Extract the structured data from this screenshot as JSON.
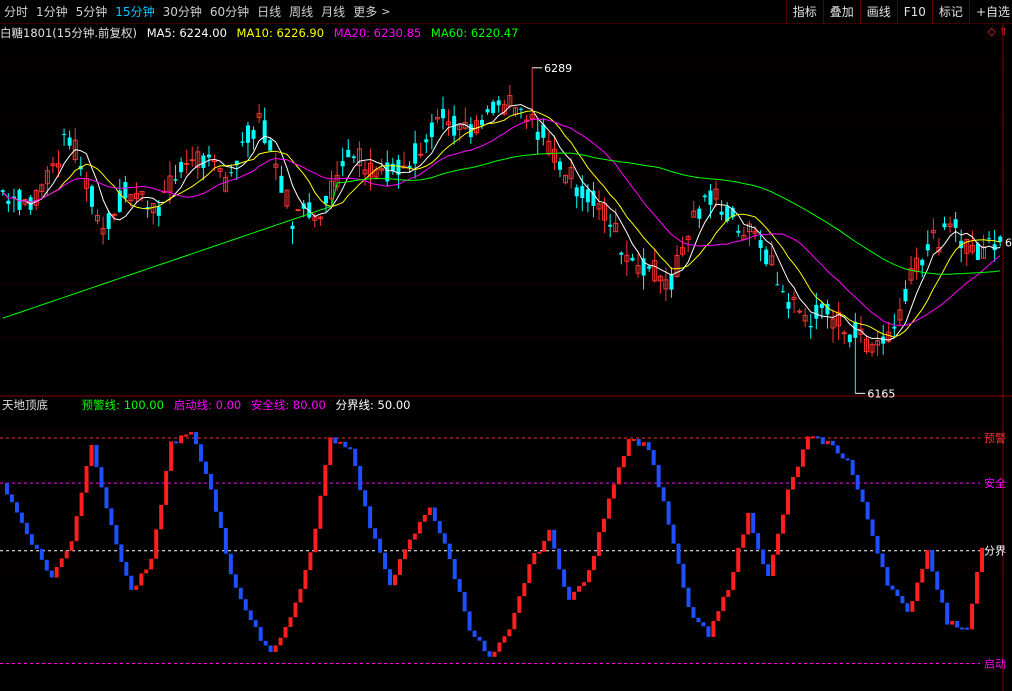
{
  "period_tabs": [
    {
      "label": "分时",
      "active": false
    },
    {
      "label": "1分钟",
      "active": false
    },
    {
      "label": "5分钟",
      "active": false
    },
    {
      "label": "15分钟",
      "active": true
    },
    {
      "label": "30分钟",
      "active": false
    },
    {
      "label": "60分钟",
      "active": false
    },
    {
      "label": "日线",
      "active": false
    },
    {
      "label": "周线",
      "active": false
    },
    {
      "label": "月线",
      "active": false
    }
  ],
  "more_label": "更多",
  "right_tools": [
    "指标",
    "叠加",
    "画线",
    "F10",
    "标记",
    "+自选"
  ],
  "main_panel": {
    "symbol": "白糖1801(15分钟.前复权)",
    "ma5": {
      "label": "MA5:",
      "value": "6224.00",
      "color": "#ffffff"
    },
    "ma10": {
      "label": "MA10:",
      "value": "6226.90",
      "color": "#ffff00"
    },
    "ma20": {
      "label": "MA20:",
      "value": "6230.85",
      "color": "#ff00ff"
    },
    "ma60": {
      "label": "MA60:",
      "value": "6220.47",
      "color": "#00ff00"
    },
    "high_marker": "6289",
    "low_marker": "6165",
    "right_price_tag": "6",
    "corner_icons": [
      "diamond-icon",
      "up-arrow-icon"
    ]
  },
  "indicator_panel": {
    "name": "天地顶底",
    "lines": [
      {
        "label": "预警线:",
        "value": "100.00",
        "color": "#00ff00"
      },
      {
        "label": "启动线:",
        "value": "0.00",
        "color": "#ff00ff"
      },
      {
        "label": "安全线:",
        "value": "80.00",
        "color": "#ff00ff"
      },
      {
        "label": "分界线:",
        "value": "50.00",
        "color": "#ffffff"
      }
    ],
    "level_tags": [
      {
        "label": "预警",
        "value": 100,
        "color": "#ff3030"
      },
      {
        "label": "安全",
        "value": 80,
        "color": "#ff00ff"
      },
      {
        "label": "分界",
        "value": 50,
        "color": "#ffffff"
      },
      {
        "label": "启动",
        "value": 0,
        "color": "#ff00ff"
      }
    ]
  },
  "colors": {
    "up": "#ff3232",
    "down": "#00ffff",
    "osc_up": "#ff1e1e",
    "osc_down": "#1e50ff",
    "ma5": "#ffffff",
    "ma10": "#ffff00",
    "ma20": "#ff00ff",
    "ma60": "#00ff00"
  }
}
